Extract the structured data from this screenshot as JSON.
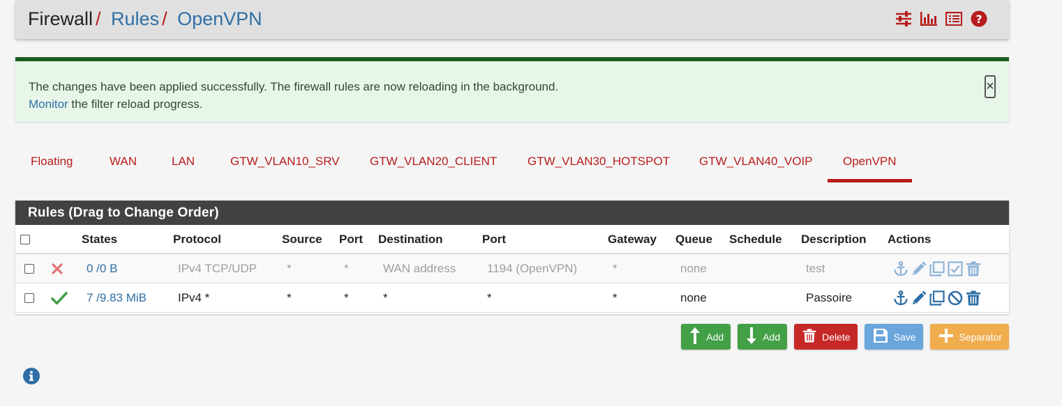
{
  "breadcrumb": {
    "root": "Firewall",
    "sep": "/",
    "level2": "Rules",
    "level3": "OpenVPN"
  },
  "header_icons": [
    "sliders-icon",
    "bar-chart-icon",
    "list-alt-icon",
    "help-icon"
  ],
  "alert": {
    "line1": "The changes have been applied successfully. The firewall rules are now reloading in the background.",
    "monitor_link": "Monitor",
    "line2_rest": " the filter reload progress.",
    "close": "×"
  },
  "tabs": [
    "Floating",
    "WAN",
    "LAN",
    "GTW_VLAN10_SRV",
    "GTW_VLAN20_CLIENT",
    "GTW_VLAN30_HOTSPOT",
    "GTW_VLAN40_VOIP",
    "OpenVPN"
  ],
  "active_tab": "OpenVPN",
  "panel": {
    "title": "Rules (Drag to Change Order)",
    "columns": [
      "States",
      "Protocol",
      "Source",
      "Port",
      "Destination",
      "Port",
      "Gateway",
      "Queue",
      "Schedule",
      "Description",
      "Actions"
    ],
    "rows": [
      {
        "enabled": false,
        "status_icon": "times-icon",
        "states": "0 /0 B",
        "protocol": "IPv4 TCP/UDP",
        "source": "*",
        "source_port": "*",
        "destination": "WAN address",
        "dest_port": "1194 (OpenVPN)",
        "gateway": "*",
        "queue": "none",
        "schedule": "",
        "description": "test"
      },
      {
        "enabled": true,
        "status_icon": "check-icon",
        "states": "7 /9.83 MiB",
        "protocol": "IPv4 *",
        "source": "*",
        "source_port": "*",
        "destination": "*",
        "dest_port": "*",
        "gateway": "*",
        "queue": "none",
        "schedule": "",
        "description": "Passoire"
      }
    ]
  },
  "buttons": {
    "add_top": "Add",
    "add_bottom": "Add",
    "delete": "Delete",
    "save": "Save",
    "separator": "Separator"
  },
  "colors": {
    "brand_red": "#b71c1c",
    "link_blue": "#2f6fa5",
    "header_dark": "#424242",
    "success_green": "#43a047",
    "alert_bg": "#e8f5e9"
  }
}
